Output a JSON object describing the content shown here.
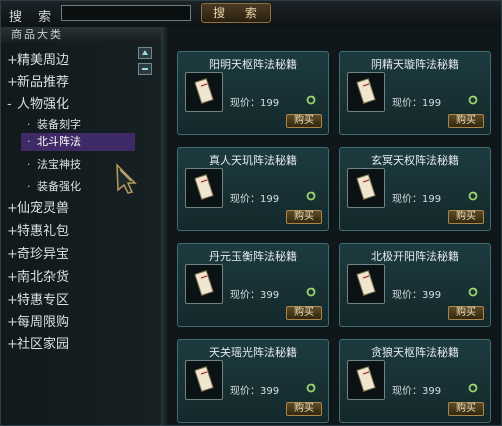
{
  "search": {
    "label": "搜 索",
    "input_value": "",
    "button_label": "搜 索"
  },
  "sidebar": {
    "header": "商品大类",
    "categories": [
      {
        "symbol": "+",
        "label": "精美周边"
      },
      {
        "symbol": "+",
        "label": "新品推荐"
      },
      {
        "symbol": "-",
        "label": "人物强化"
      },
      {
        "symbol": "+",
        "label": "仙宠灵兽"
      },
      {
        "symbol": "+",
        "label": "特惠礼包"
      },
      {
        "symbol": "+",
        "label": "奇珍异宝"
      },
      {
        "symbol": "+",
        "label": "南北杂货"
      },
      {
        "symbol": "+",
        "label": "特惠专区"
      },
      {
        "symbol": "+",
        "label": "每周限购"
      },
      {
        "symbol": "+",
        "label": "社区家园"
      }
    ],
    "subitems": [
      {
        "bullet": "·",
        "label": "装备刻字"
      },
      {
        "bullet": "·",
        "label": "北斗阵法"
      },
      {
        "bullet": "·",
        "label": "法宝神技"
      },
      {
        "bullet": "·",
        "label": "装备强化"
      }
    ]
  },
  "items": [
    {
      "name": "阳明天枢阵法秘籍",
      "price": "现价：199",
      "buy": "购买"
    },
    {
      "name": "阴精天璇阵法秘籍",
      "price": "现价：199",
      "buy": "购买"
    },
    {
      "name": "真人天玑阵法秘籍",
      "price": "现价：199",
      "buy": "购买"
    },
    {
      "name": "玄冥天权阵法秘籍",
      "price": "现价：199",
      "buy": "购买"
    },
    {
      "name": "丹元玉衡阵法秘籍",
      "price": "现价：399",
      "buy": "购买"
    },
    {
      "name": "北极开阳阵法秘籍",
      "price": "现价：399",
      "buy": "购买"
    },
    {
      "name": "天关瑶光阵法秘籍",
      "price": "现价：399",
      "buy": "购买"
    },
    {
      "name": "贪狼天枢阵法秘籍",
      "price": "现价：399",
      "buy": "购买"
    }
  ],
  "colors": {
    "accent_gold": "#a9874c",
    "card_teal": "#1d3b3f",
    "selected": "#3d2a66"
  },
  "icons": {
    "item": "scroll-icon",
    "refresh": "refresh-icon",
    "scroll": "scroll-up-icon"
  }
}
